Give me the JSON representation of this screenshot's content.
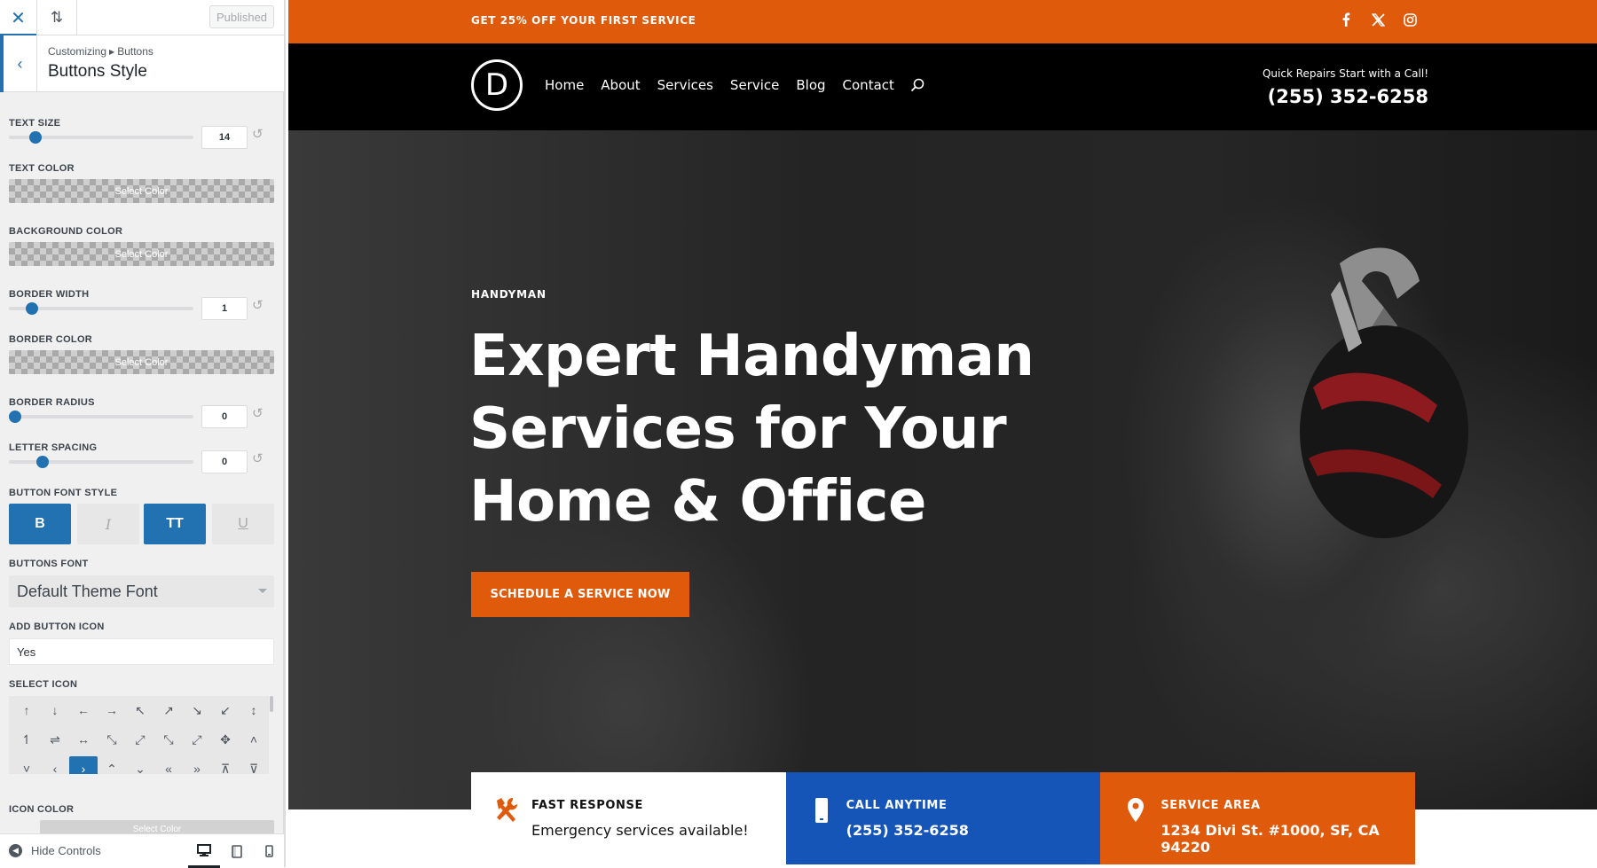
{
  "customizer": {
    "published_label": "Published",
    "breadcrumb": {
      "root": "Customizing",
      "parent": "Buttons"
    },
    "section_title": "Buttons Style",
    "controls": {
      "text_size": {
        "label": "TEXT SIZE",
        "value": "14",
        "level": 0.12
      },
      "text_color": {
        "label": "TEXT COLOR",
        "placeholder": "Select Color"
      },
      "background_color": {
        "label": "BACKGROUND COLOR",
        "placeholder": "Select Color"
      },
      "border_width": {
        "label": "BORDER WIDTH",
        "value": "1",
        "level": 0.1
      },
      "border_color": {
        "label": "BORDER COLOR",
        "placeholder": "Select Color"
      },
      "border_radius": {
        "label": "BORDER RADIUS",
        "value": "0",
        "level": 0.0
      },
      "letter_spacing": {
        "label": "LETTER SPACING",
        "value": "0",
        "level": 0.16
      },
      "font_style": {
        "label": "BUTTON FONT STYLE",
        "buttons": [
          {
            "glyph": "B",
            "active": true
          },
          {
            "glyph": "I",
            "active": false
          },
          {
            "glyph": "TT",
            "active": true
          },
          {
            "glyph": "U",
            "active": false
          }
        ]
      },
      "buttons_font": {
        "label": "BUTTONS FONT",
        "value": "Default Theme Font"
      },
      "add_button_icon": {
        "label": "ADD BUTTON ICON",
        "value": "Yes"
      },
      "select_icon": {
        "label": "SELECT ICON",
        "icons": [
          "↑",
          "↓",
          "←",
          "→",
          "↖",
          "↗",
          "↘",
          "↙",
          "↕",
          "↿",
          "⇌",
          "↔",
          "⤡",
          "⤢",
          "⤡",
          "⤢",
          "✥",
          "˄",
          "˅",
          "‹",
          "›",
          "⌃",
          "⌄",
          "«",
          "»",
          "⊼",
          "⊽"
        ],
        "selected_index": 20
      },
      "icon_color": {
        "label": "ICON COLOR",
        "placeholder": "Select Color"
      }
    },
    "footer": {
      "hide_controls": "Hide Controls",
      "active_device": "desktop"
    }
  },
  "site": {
    "accent": "#e05a0c",
    "blue": "#1655b8",
    "promo": "GET 25% OFF YOUR FIRST SERVICE",
    "social": [
      "facebook-icon",
      "x-icon",
      "instagram-icon"
    ],
    "logo_letter": "D",
    "nav": [
      "Home",
      "About",
      "Services",
      "Service",
      "Blog",
      "Contact"
    ],
    "call_tagline": "Quick Repairs Start with a Call!",
    "phone": "(255) 352-6258",
    "hero": {
      "tag": "HANDYMAN",
      "title": "Expert Handyman Services for Your Home & Office",
      "cta": "SCHEDULE A SERVICE NOW"
    },
    "info_cards": [
      {
        "title": "FAST RESPONSE",
        "value": "Emergency services available!",
        "icon": "tools-icon"
      },
      {
        "title": "CALL ANYTIME",
        "value": "(255) 352-6258",
        "icon": "phone-icon"
      },
      {
        "title": "SERVICE AREA",
        "value": "1234 Divi St. #1000, SF, CA 94220",
        "icon": "map-pin-icon"
      }
    ]
  }
}
